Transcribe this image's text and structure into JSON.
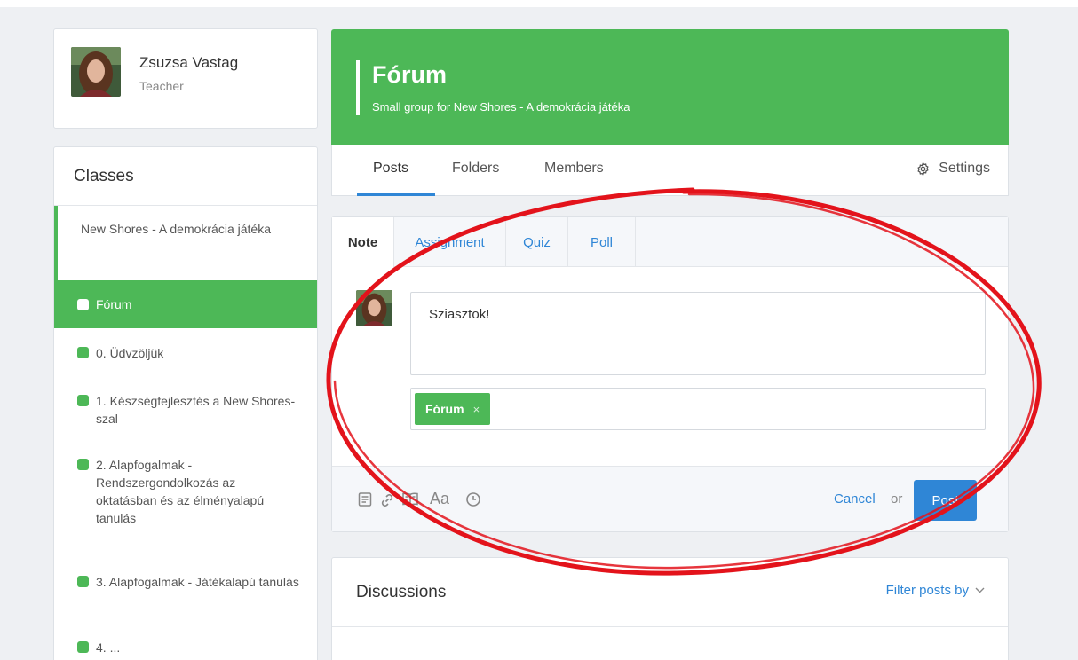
{
  "profile": {
    "name": "Zsuzsa Vastag",
    "role": "Teacher"
  },
  "classes": {
    "title": "Classes",
    "parent": "New Shores - A demokrácia játéka",
    "groups": [
      {
        "label": "Fórum",
        "active": true
      },
      {
        "label": "0. Üdvzöljük"
      },
      {
        "label": "1. Készségfejlesztés a New Shores-szal"
      },
      {
        "label": "2. Alapfogalmak - Rendszergondolkozás az oktatásban és az élményalapú tanulás"
      },
      {
        "label": "3. Alapfogalmak - Játékalapú tanulás"
      },
      {
        "label": "4. ..."
      }
    ]
  },
  "header": {
    "title": "Fórum",
    "subtitle": "Small group for New Shores - A demokrácia játéka",
    "tabs": [
      "Posts",
      "Folders",
      "Members"
    ],
    "settings_label": "Settings"
  },
  "composer": {
    "tabs": [
      "Note",
      "Assignment",
      "Quiz",
      "Poll"
    ],
    "note_text": "Sziasztok!",
    "recipient": "Fórum",
    "remove_symbol": "×",
    "aa_label": "Aa",
    "cancel_label": "Cancel",
    "or_label": "or",
    "post_label": "Post"
  },
  "discussions": {
    "title": "Discussions",
    "filter_label": "Filter posts by"
  },
  "colors": {
    "green": "#4db857",
    "blue": "#2f86d6",
    "annotation_red": "#e3131b"
  }
}
